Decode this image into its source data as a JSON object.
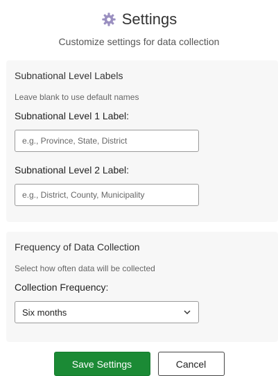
{
  "header": {
    "title": "Settings",
    "subtitle": "Customize settings for data collection",
    "icon": "gear-icon"
  },
  "subnational": {
    "section_title": "Subnational Level Labels",
    "description": "Leave blank to use default names",
    "level1": {
      "label": "Subnational Level 1 Label:",
      "value": "",
      "placeholder": "e.g., Province, State, District"
    },
    "level2": {
      "label": "Subnational Level 2 Label:",
      "value": "",
      "placeholder": "e.g., District, County, Municipality"
    }
  },
  "frequency": {
    "section_title": "Frequency of Data Collection",
    "description": "Select how often data will be collected",
    "field_label": "Collection Frequency:",
    "selected": "Six months",
    "icon": "chevron-down-icon"
  },
  "actions": {
    "save_label": "Save Settings",
    "cancel_label": "Cancel"
  },
  "colors": {
    "primary": "#1b8a35",
    "card_background": "#f7f7f7",
    "gear_icon": "#9a8fc0"
  }
}
